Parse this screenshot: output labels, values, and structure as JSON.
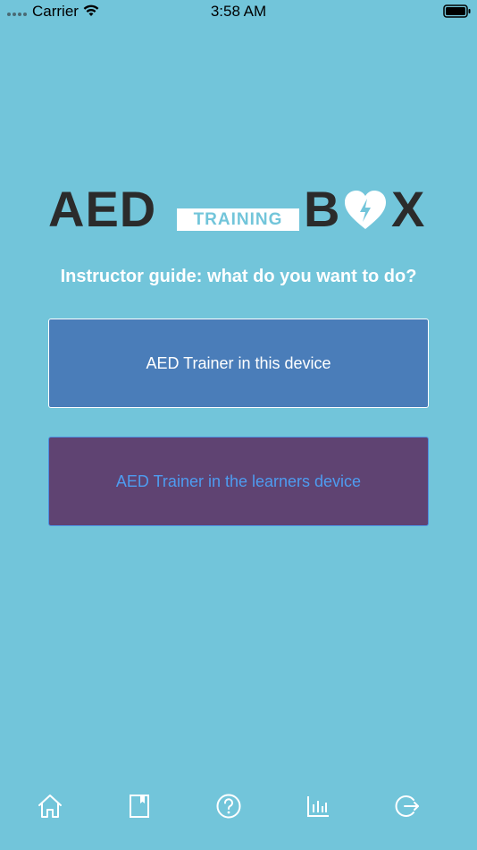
{
  "status_bar": {
    "carrier": "Carrier",
    "time": "3:58 AM"
  },
  "logo": {
    "aed": "AED",
    "training": "TRAINING",
    "b": "B",
    "x": "X",
    "heart_icon": "heart-lightning-icon"
  },
  "prompt": "Instructor guide: what do you want to do?",
  "options": {
    "this_device": "AED Trainer in this device",
    "learners_device": "AED Trainer in the learners device"
  },
  "tabs": [
    {
      "icon": "home-icon"
    },
    {
      "icon": "book-icon"
    },
    {
      "icon": "help-icon"
    },
    {
      "icon": "stats-icon"
    },
    {
      "icon": "logout-icon"
    }
  ],
  "colors": {
    "background": "#72c5da",
    "btn_this_bg": "#4a7db9",
    "btn_learners_bg": "#5f4372",
    "btn_learners_text": "#4e9cf0",
    "logo_dark": "#2b2b2b",
    "tab_icon": "#ffffff"
  }
}
